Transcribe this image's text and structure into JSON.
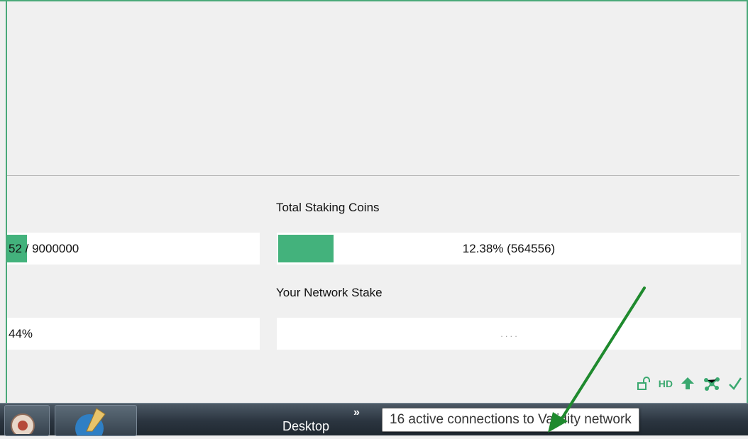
{
  "overview": {
    "total_staking_label": "Total Staking Coins",
    "network_stake_label": "Your Network Stake",
    "supply_value": "52 / 9000000",
    "supply_progress": 0.09,
    "staking_value": "12.38% (564556)",
    "staking_progress": 0.1238,
    "left_percent_value": "44%",
    "network_stake_value": ". . . ."
  },
  "status_bar": {
    "hd_label": "HD",
    "icons": [
      "unlock-icon",
      "hd-icon",
      "staking-arrow-icon",
      "network-connections-icon",
      "synced-check-icon"
    ]
  },
  "taskbar": {
    "desktop_label": "Desktop",
    "chevron_label": "»"
  },
  "tooltip": {
    "text": "16 active connections to Validity network"
  },
  "colors": {
    "accent": "#43b27c",
    "arrow": "#1f8a2e"
  }
}
